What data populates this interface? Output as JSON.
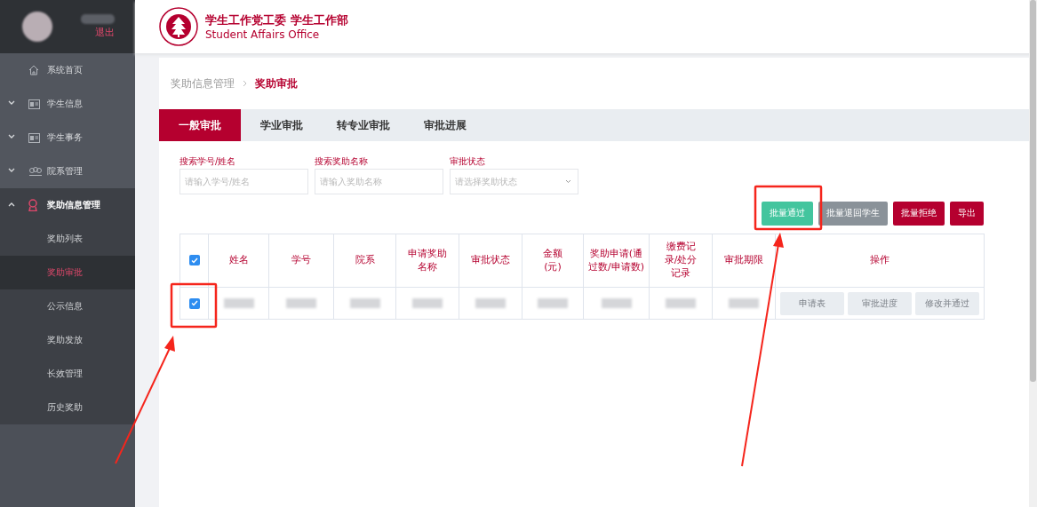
{
  "header": {
    "logout": "退出",
    "title": "学生工作党工委 学生工作部",
    "subtitle": "Student Affairs Office"
  },
  "sidebar": {
    "items": [
      {
        "label": "系统首页",
        "kind": "link"
      },
      {
        "label": "学生信息",
        "kind": "group",
        "expanded": false
      },
      {
        "label": "学生事务",
        "kind": "group",
        "expanded": false
      },
      {
        "label": "院系管理",
        "kind": "group",
        "expanded": false
      },
      {
        "label": "奖助信息管理",
        "kind": "group",
        "expanded": true,
        "children": [
          {
            "label": "奖助列表",
            "selected": false
          },
          {
            "label": "奖助审批",
            "selected": true
          },
          {
            "label": "公示信息",
            "selected": false
          },
          {
            "label": "奖助发放",
            "selected": false
          },
          {
            "label": "长效管理",
            "selected": false
          },
          {
            "label": "历史奖助",
            "selected": false
          }
        ]
      }
    ]
  },
  "breadcrumb": [
    "奖助信息管理",
    "奖助审批"
  ],
  "tabs": [
    {
      "label": "一般审批",
      "selected": true
    },
    {
      "label": "学业审批",
      "selected": false
    },
    {
      "label": "转专业审批",
      "selected": false
    },
    {
      "label": "审批进展",
      "selected": false
    }
  ],
  "filters": [
    {
      "label": "搜索学号/姓名",
      "placeholder": "请输入学号/姓名",
      "kind": "input"
    },
    {
      "label": "搜索奖助名称",
      "placeholder": "请输入奖助名称",
      "kind": "input"
    },
    {
      "label": "审批状态",
      "placeholder": "请选择奖助状态",
      "kind": "select"
    }
  ],
  "buttons": [
    {
      "label": "批量通过",
      "kind": "success"
    },
    {
      "label": "批量退回学生",
      "kind": "secondary"
    },
    {
      "label": "批量拒绝",
      "kind": "danger"
    },
    {
      "label": "导出",
      "kind": "danger"
    }
  ],
  "table": {
    "all_checked": true,
    "columns": [
      "姓名",
      "学号",
      "院系",
      "申请奖助名称",
      "审批状态",
      "金额(元)",
      "奖助申请(通过数/申请数)",
      "缴费记录/处分记录",
      "审批期限",
      "操作"
    ],
    "rows": [
      {
        "checked": true,
        "actions": [
          "申请表",
          "审批进度",
          "修改并通过"
        ]
      }
    ]
  }
}
